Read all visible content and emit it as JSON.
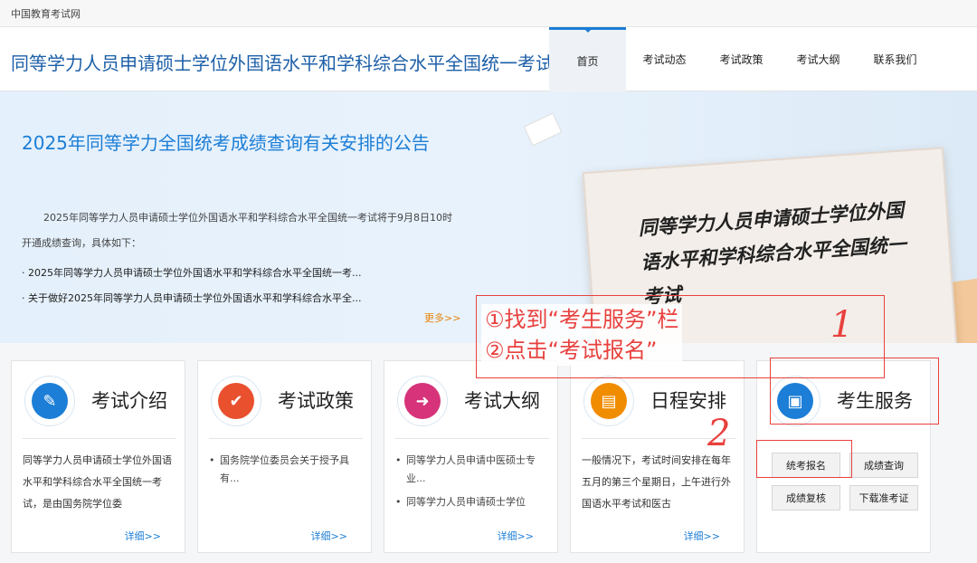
{
  "topbar": {
    "site_name": "中国教育考试网"
  },
  "header": {
    "title": "同等学力人员申请硕士学位外国语水平和学科综合水平全国统一考试"
  },
  "nav": {
    "items": [
      {
        "label": "首页"
      },
      {
        "label": "考试动态"
      },
      {
        "label": "考试政策"
      },
      {
        "label": "考试大纲"
      },
      {
        "label": "联系我们"
      }
    ]
  },
  "banner": {
    "headline": "2025年同等学力全国统考成绩查询有关安排的公告",
    "intro": "2025年同等学力人员申请硕士学位外国语水平和学科综合水平全国统一考试将于9月8日10时开通成绩查询，具体如下：",
    "bullets": [
      "2025年同等学力人员申请硕士学位外国语水平和学科综合水平全国统一考...",
      "关于做好2025年同等学力人员申请硕士学位外国语水平和学科综合水平全..."
    ],
    "more": "更多>>",
    "board_text": "同等学力人员申请硕士学位外国语水平和学科综合水平全国统一考试"
  },
  "annotation": {
    "line1": "①找到“考生服务”栏",
    "line2": "②点击“考试报名”",
    "mark1": "1",
    "mark2": "2"
  },
  "cards": [
    {
      "title": "考试介绍",
      "icon": "document-icon",
      "color": "#1c7ed6",
      "body": "同等学力人员申请硕士学位外国语水平和学科综合水平全国统一考试，是由国务院学位委",
      "detail": "详细>>"
    },
    {
      "title": "考试政策",
      "icon": "check-icon",
      "color": "#e8502e",
      "list": [
        "国务院学位委员会关于授予具有..."
      ],
      "detail": "详细>>"
    },
    {
      "title": "考试大纲",
      "icon": "outline-icon",
      "color": "#d6337a",
      "list": [
        "同等学力人员申请中医硕士专业...",
        "同等学力人员申请硕士学位"
      ],
      "detail": "详细>>"
    },
    {
      "title": "日程安排",
      "icon": "calendar-icon",
      "color": "#f08c00",
      "body": "一般情况下，考试时间安排在每年五月的第三个星期日，上午进行外国语水平考试和医古",
      "detail": "详细>>"
    },
    {
      "title": "考生服务",
      "icon": "id-card-icon",
      "color": "#1c7ed6"
    }
  ],
  "services": {
    "register": "统考报名",
    "score_query": "成绩查询",
    "score_review": "成绩复核",
    "admit_ticket": "下载准考证"
  },
  "colors": {
    "accent": "#1c7ed6",
    "annotation": "#e8413e",
    "more": "#e8840c"
  }
}
